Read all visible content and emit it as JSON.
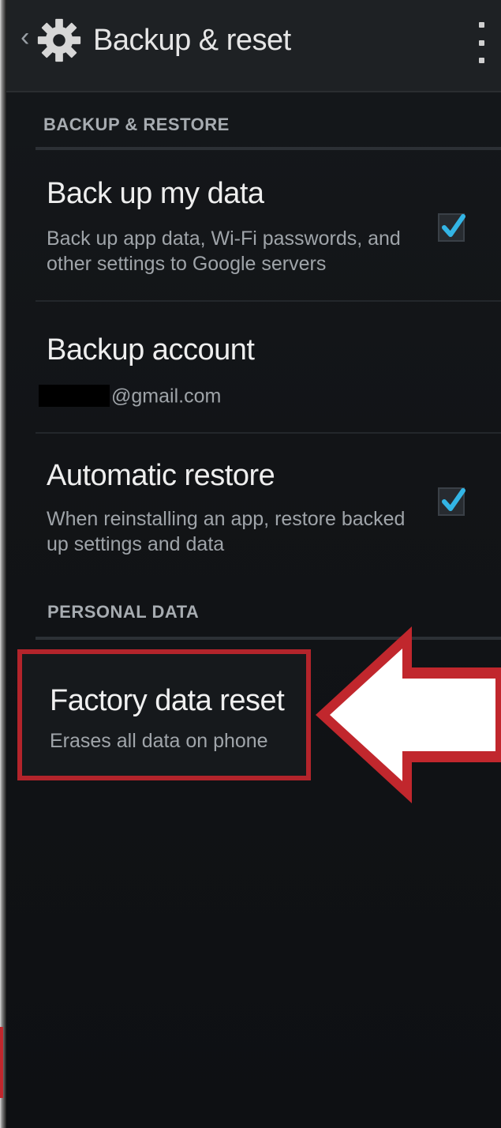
{
  "app_bar": {
    "title": "Backup & reset",
    "back_icon": "chevron-left-icon",
    "settings_icon": "gear-icon",
    "menu_icon": "overflow-menu-icon"
  },
  "sections": {
    "backup_restore": {
      "header": "BACKUP & RESTORE",
      "items": [
        {
          "title": "Back up my data",
          "summary": "Back up app data, Wi-Fi passwords, and other settings to Google servers",
          "checked": true
        },
        {
          "title": "Backup account",
          "summary": "@gmail.com"
        },
        {
          "title": "Automatic restore",
          "summary": "When reinstalling an app, restore backed up settings and data",
          "checked": true
        }
      ]
    },
    "personal_data": {
      "header": "PERSONAL DATA",
      "items": [
        {
          "title": "Factory data reset",
          "summary": "Erases all data on phone"
        }
      ]
    }
  },
  "colors": {
    "accent_check": "#33b5e5",
    "highlight_red": "#c1272d",
    "background": "#121417"
  }
}
